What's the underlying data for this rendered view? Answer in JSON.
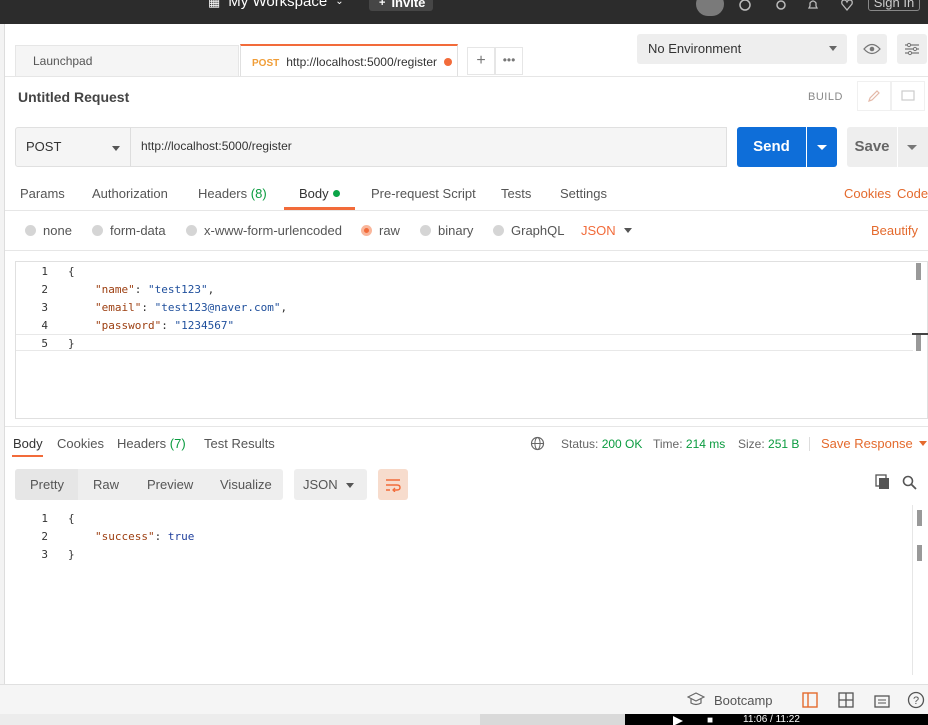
{
  "topbar": {
    "workspace_label": "My Workspace",
    "invite_label": "Invite",
    "signin_label": "Sign In"
  },
  "tabs": {
    "launchpad": "Launchpad",
    "active_method": "POST",
    "active_url": "http://localhost:5000/register"
  },
  "environment": {
    "selected": "No Environment"
  },
  "request": {
    "title": "Untitled Request",
    "build_label": "BUILD",
    "method": "POST",
    "url": "http://localhost:5000/register",
    "send_label": "Send",
    "save_label": "Save",
    "tabs": {
      "params": "Params",
      "authorization": "Authorization",
      "headers": "Headers",
      "headers_count": "(8)",
      "body": "Body",
      "prerequest": "Pre-request Script",
      "tests": "Tests",
      "settings": "Settings"
    },
    "cookies_link": "Cookies",
    "code_link": "Code",
    "body_types": {
      "none": "none",
      "form_data": "form-data",
      "urlencoded": "x-www-form-urlencoded",
      "raw": "raw",
      "binary": "binary",
      "graphql": "GraphQL",
      "format": "JSON"
    },
    "beautify_label": "Beautify",
    "line_numbers": [
      "1",
      "2",
      "3",
      "4",
      "5"
    ],
    "code_lines": {
      "l1": "{",
      "l2_key": "\"name\"",
      "l2_val": "\"test123\"",
      "l3_key": "\"email\"",
      "l3_val": "\"test123@naver.com\"",
      "l4_key": "\"password\"",
      "l4_val": "\"1234567\"",
      "l5": "}"
    }
  },
  "response": {
    "tabs": {
      "body": "Body",
      "cookies": "Cookies",
      "headers": "Headers",
      "headers_count": "(7)",
      "test_results": "Test Results"
    },
    "status_label": "Status:",
    "status_value": "200 OK",
    "time_label": "Time:",
    "time_value": "214 ms",
    "size_label": "Size:",
    "size_value": "251 B",
    "save_response_label": "Save Response",
    "views": {
      "pretty": "Pretty",
      "raw": "Raw",
      "preview": "Preview",
      "visualize": "Visualize"
    },
    "format": "JSON",
    "line_numbers": [
      "1",
      "2",
      "3"
    ],
    "code_lines": {
      "l1": "{",
      "l2_key": "\"success\"",
      "l2_val": "true",
      "l3": "}"
    }
  },
  "statusbar": {
    "bootcamp_label": "Bootcamp",
    "video_time": "11:06 / 11:22"
  },
  "colors": {
    "accent": "#f26b3a",
    "send_blue": "#0e6ed9",
    "ok_green": "#0a9b3f"
  }
}
